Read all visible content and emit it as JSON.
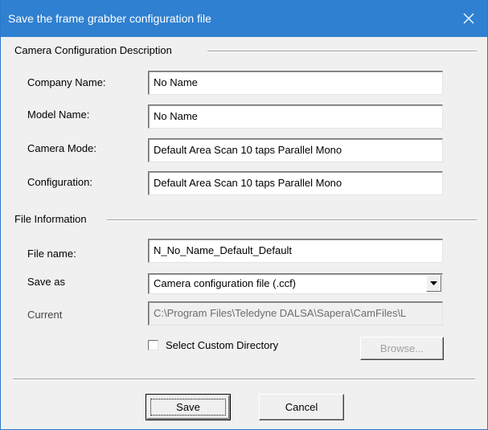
{
  "window": {
    "title": "Save the frame grabber configuration file",
    "close_icon": "close-icon"
  },
  "camera_group": {
    "title": "Camera Configuration Description",
    "fields": [
      {
        "label": "Company Name:",
        "value": "No Name"
      },
      {
        "label": "Model Name:",
        "value": "No Name"
      },
      {
        "label": "Camera Mode:",
        "value": "Default Area Scan 10 taps Parallel Mono"
      },
      {
        "label": "Configuration:",
        "value": "Default Area Scan 10 taps Parallel Mono"
      }
    ]
  },
  "file_group": {
    "title": "File Information",
    "file_name": {
      "label": "File name:",
      "value": "N_No_Name_Default_Default"
    },
    "save_as": {
      "label": "Save as",
      "selected": "Camera configuration file (.ccf)",
      "icon": "chevron-down-icon"
    },
    "current": {
      "label": "Current",
      "value": "C:\\Program Files\\Teledyne DALSA\\Sapera\\CamFiles\\L"
    },
    "custom_dir": {
      "label": "Select Custom Directory",
      "checked": false
    },
    "browse_label": "Browse..."
  },
  "buttons": {
    "save": "Save",
    "cancel": "Cancel"
  },
  "colors": {
    "titlebar": "#2f80d0",
    "dialog_background": "#f0f0f0",
    "disabled_text": "#a0a0a0"
  }
}
